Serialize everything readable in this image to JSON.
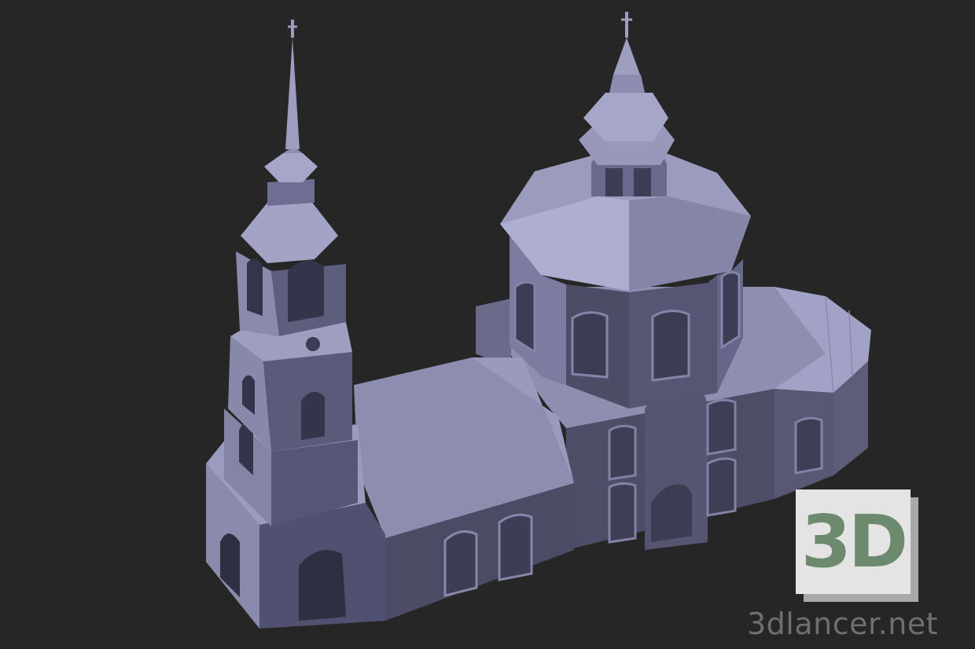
{
  "image": {
    "subject": "",
    "background_color": "#262626",
    "model_color": "#7d7d9c"
  },
  "badge": {
    "text": "3D",
    "text_color": "#6d8a6e",
    "face_color": "#e4e4e4"
  },
  "watermark": {
    "text": "3dlancer.net"
  }
}
